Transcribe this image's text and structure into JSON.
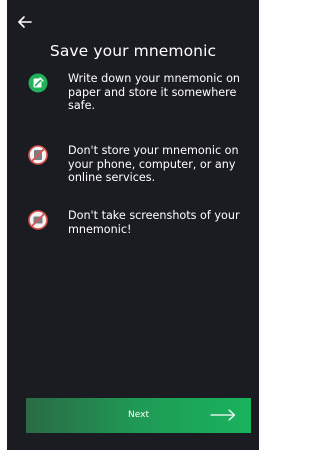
{
  "header": {
    "back_icon": "arrow-left-icon",
    "title": "Save your mnemonic"
  },
  "tips": [
    {
      "icon": "check-note-icon",
      "status": "allowed",
      "text": "Write down your mnemonic on paper and store it somewhere safe."
    },
    {
      "icon": "no-device-icon",
      "status": "forbidden",
      "text": "Don't store your mnemonic on your phone, computer, or any online services."
    },
    {
      "icon": "no-screenshot-icon",
      "status": "forbidden",
      "text": "Don't take screenshots of your mnemonic!"
    }
  ],
  "footer": {
    "next_label": "Next",
    "next_icon": "arrow-right-icon"
  },
  "colors": {
    "background": "#1b1c22",
    "accent_green": "#1fb25a",
    "forbidden_red": "#d9534f"
  }
}
